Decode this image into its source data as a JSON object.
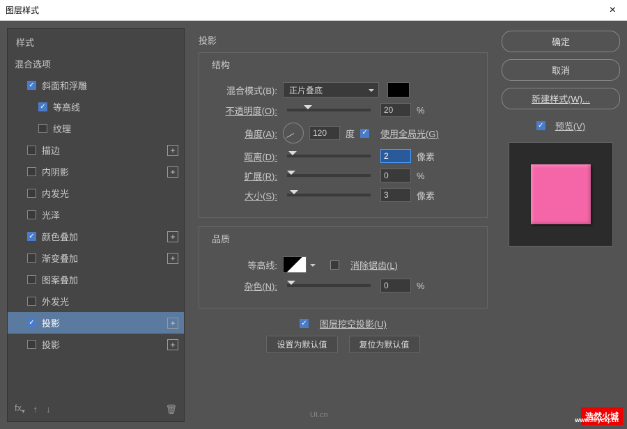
{
  "titlebar": {
    "title": "图层样式",
    "close": "×"
  },
  "sidebar": {
    "styles_header": "样式",
    "blend_options": "混合选项",
    "items": [
      {
        "label": "斜面和浮雕",
        "checked": true,
        "indent": 1
      },
      {
        "label": "等高线",
        "checked": true,
        "indent": 2
      },
      {
        "label": "纹理",
        "checked": false,
        "indent": 2
      },
      {
        "label": "描边",
        "checked": false,
        "indent": 1,
        "add": true
      },
      {
        "label": "内阴影",
        "checked": false,
        "indent": 1,
        "add": true
      },
      {
        "label": "内发光",
        "checked": false,
        "indent": 1
      },
      {
        "label": "光泽",
        "checked": false,
        "indent": 1
      },
      {
        "label": "颜色叠加",
        "checked": true,
        "indent": 1,
        "add": true
      },
      {
        "label": "渐变叠加",
        "checked": false,
        "indent": 1,
        "add": true
      },
      {
        "label": "图案叠加",
        "checked": false,
        "indent": 1
      },
      {
        "label": "外发光",
        "checked": false,
        "indent": 1
      },
      {
        "label": "投影",
        "checked": true,
        "indent": 1,
        "add": true,
        "selected": true
      },
      {
        "label": "投影",
        "checked": false,
        "indent": 1,
        "add": true
      }
    ],
    "fx": "fx",
    "arrow_up": "↑",
    "arrow_down": "↓",
    "trash": "🗑"
  },
  "center": {
    "panel_title": "投影",
    "structure": {
      "title": "结构",
      "blend_mode_label": "混合模式(B):",
      "blend_mode_value": "正片叠底",
      "opacity_label": "不透明度(O):",
      "opacity_value": "20",
      "opacity_unit": "%",
      "angle_label": "角度(A):",
      "angle_value": "120",
      "angle_unit": "度",
      "global_light_label": "使用全局光(G)",
      "distance_label": "距离(D):",
      "distance_value": "2",
      "distance_unit": "像素",
      "spread_label": "扩展(R):",
      "spread_value": "0",
      "spread_unit": "%",
      "size_label": "大小(S):",
      "size_value": "3",
      "size_unit": "像素"
    },
    "quality": {
      "title": "品质",
      "contour_label": "等高线:",
      "antialias_label": "消除锯齿(L)",
      "noise_label": "杂色(N):",
      "noise_value": "0",
      "noise_unit": "%"
    },
    "knockout_label": "图层挖空投影(U)",
    "make_default": "设置为默认值",
    "reset_default": "复位为默认值"
  },
  "right": {
    "ok": "确定",
    "cancel": "取消",
    "new_style": "新建样式(W)...",
    "preview": "预览(V)"
  },
  "footer": {
    "ui_logo": "UI.cn",
    "watermark": "浩然火城",
    "watermark_url": "www.hryckj.cn"
  }
}
